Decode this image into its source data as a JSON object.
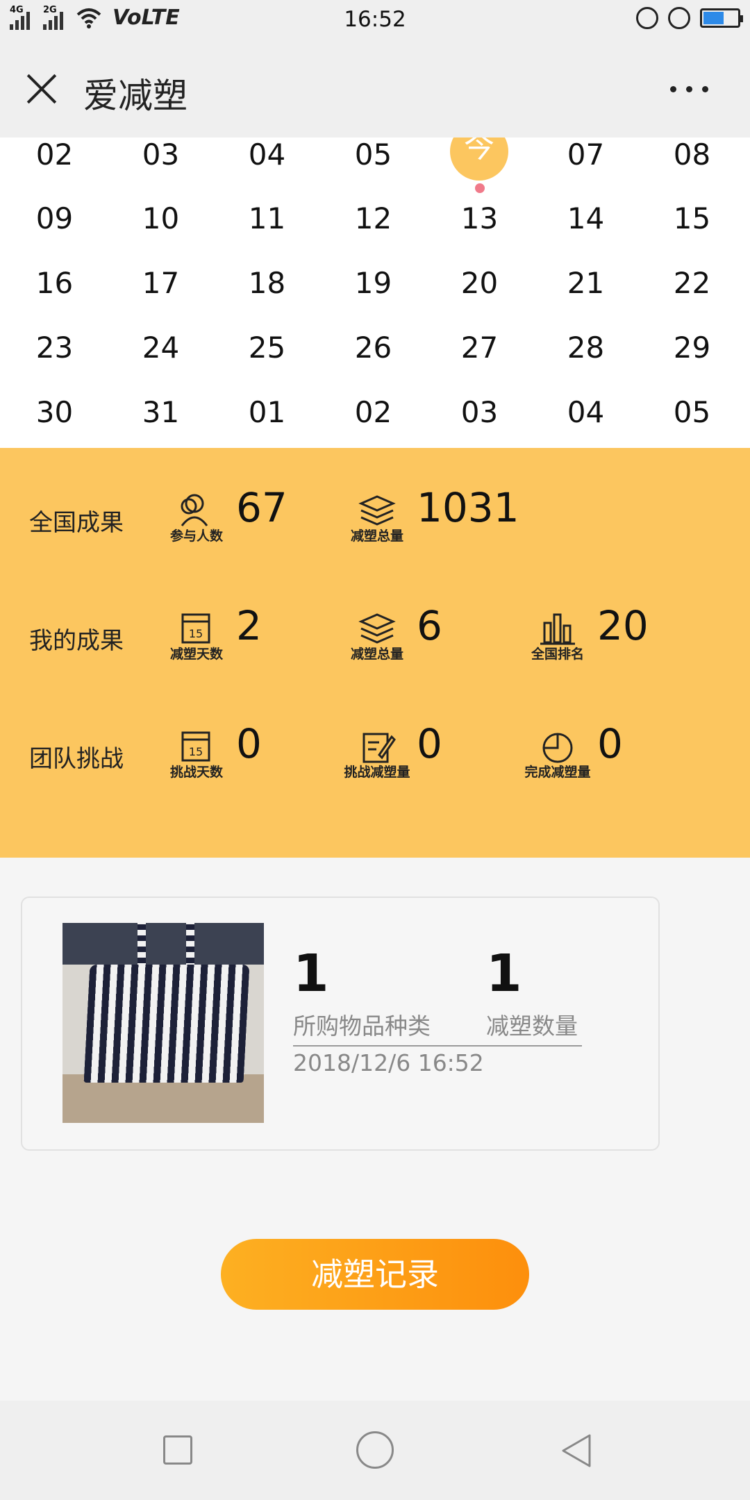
{
  "status_bar": {
    "net1": "4G",
    "net2": "2G",
    "volte": "VoLTE",
    "time": "16:52"
  },
  "nav": {
    "title": "爱减塑"
  },
  "calendar": {
    "rows": [
      [
        "02",
        "03",
        "04",
        "05",
        "今",
        "07",
        "08"
      ],
      [
        "09",
        "10",
        "11",
        "12",
        "13",
        "14",
        "15"
      ],
      [
        "16",
        "17",
        "18",
        "19",
        "20",
        "21",
        "22"
      ],
      [
        "23",
        "24",
        "25",
        "26",
        "27",
        "28",
        "29"
      ],
      [
        "30",
        "31",
        "01",
        "02",
        "03",
        "04",
        "05"
      ]
    ],
    "today_label": "今",
    "accent": "#fcc65f",
    "marker_color": "#f07a8a"
  },
  "stats": {
    "national": {
      "label": "全国成果",
      "participants": {
        "caption": "参与人数",
        "value": "67",
        "icon": "people-icon"
      },
      "total": {
        "caption": "减塑总量",
        "value": "1031",
        "icon": "layers-icon"
      }
    },
    "mine": {
      "label": "我的成果",
      "days": {
        "caption": "减塑天数",
        "value": "2",
        "icon": "calendar-icon"
      },
      "total": {
        "caption": "减塑总量",
        "value": "6",
        "icon": "layers-icon"
      },
      "rank": {
        "caption": "全国排名",
        "value": "20",
        "icon": "bar-chart-icon"
      }
    },
    "team": {
      "label": "团队挑战",
      "days": {
        "caption": "挑战天数",
        "value": "0",
        "icon": "calendar-icon"
      },
      "amount": {
        "caption": "挑战减塑量",
        "value": "0",
        "icon": "edit-icon"
      },
      "done": {
        "caption": "完成减塑量",
        "value": "0",
        "icon": "pie-icon"
      }
    },
    "background": "#fcc65f"
  },
  "record": {
    "item_kinds_value": "1",
    "item_kinds_label": "所购物品种类",
    "reduce_value": "1",
    "reduce_label": "减塑数量",
    "datetime": "2018/12/6 16:52"
  },
  "button": {
    "label": "减塑记录"
  }
}
